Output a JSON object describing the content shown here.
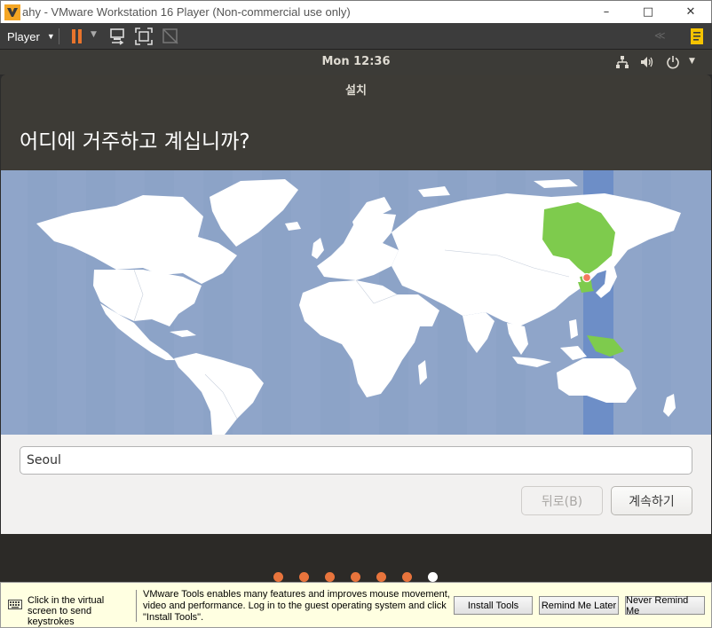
{
  "vmware": {
    "title": "ahy - VMware Workstation 16 Player (Non-commercial use only)",
    "controls": {
      "minimize": "–",
      "maximize": "□",
      "close": "✕"
    },
    "menu_label": "Player",
    "icons": [
      "vmware-logo-icon",
      "pause-icon",
      "send-ctrl-alt-del-icon",
      "fit-guest-icon",
      "unity-icon",
      "collapse-icon",
      "library-icon"
    ],
    "accent": "#e8742c"
  },
  "ubuntu_panel": {
    "clock": "Mon 12:36",
    "icons": [
      "network-icon",
      "volume-icon",
      "power-icon"
    ]
  },
  "installer": {
    "window_title": "설치",
    "question": "어디에 거주하고 계십니까?",
    "location_value": "Seoul",
    "back_label": "뒤로(B)",
    "continue_label": "계속하기",
    "selected_city": "Seoul",
    "highlight_color": "#7ecb4d",
    "timezone_band_color": "#6d8ec7"
  },
  "progress": {
    "total_steps": 7,
    "current_step": 7,
    "done_color": "#e8743c",
    "current_color": "#ffffff"
  },
  "tools_bar": {
    "hint": "Click in the virtual screen to send keystrokes",
    "message": "VMware Tools enables many features and improves mouse movement, video and performance. Log in to the guest operating system and click \"Install Tools\".",
    "install_label": "Install Tools",
    "remind_label": "Remind Me Later",
    "never_label": "Never Remind Me"
  }
}
